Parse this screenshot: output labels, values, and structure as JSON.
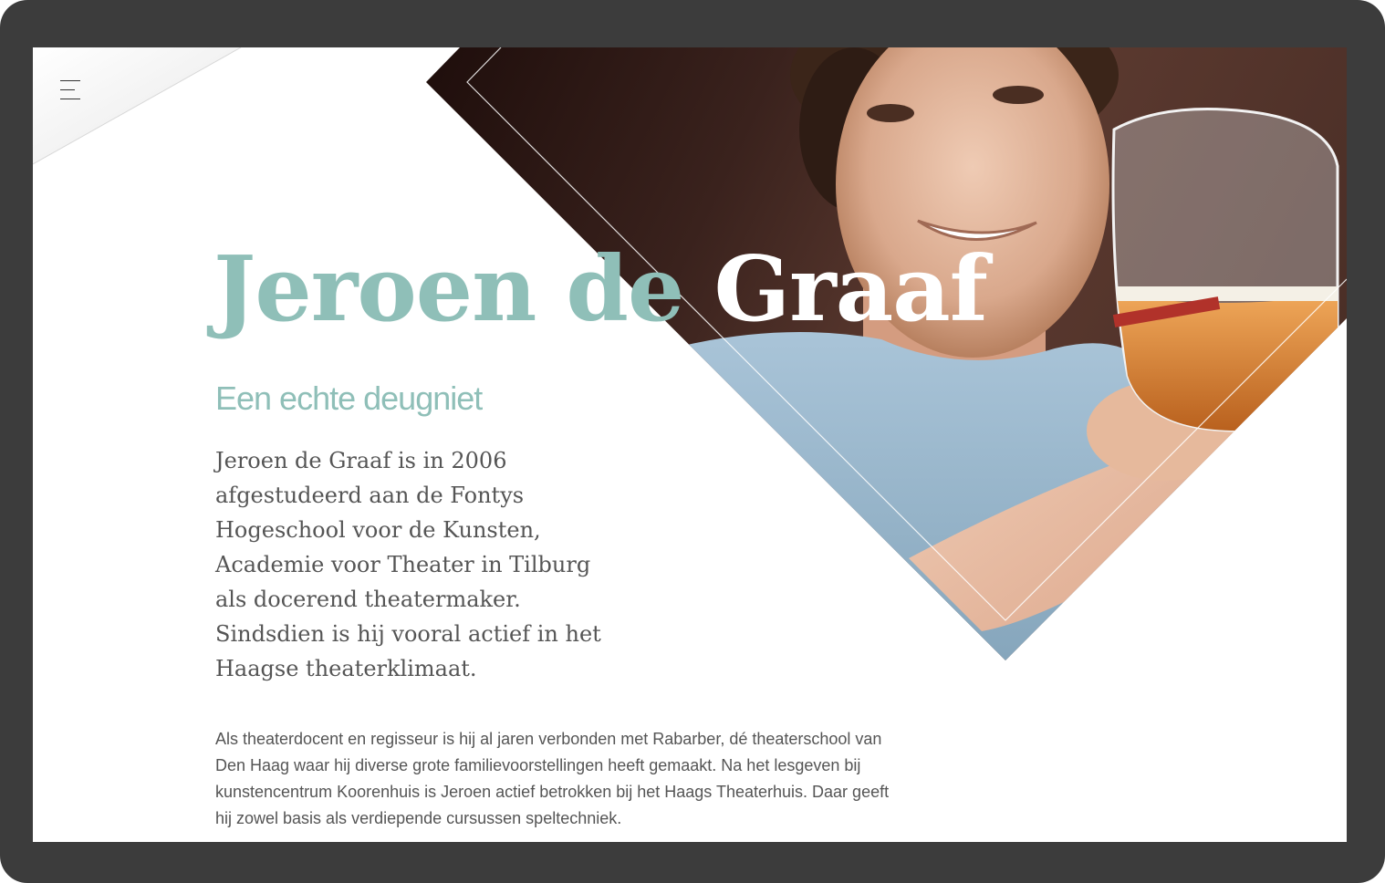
{
  "colors": {
    "frame": "#3c3c3c",
    "accent": "#8fbfb8",
    "text": "#555555",
    "background": "#ffffff"
  },
  "menu": {
    "icon": "hamburger-menu-icon"
  },
  "hero": {
    "name_part1": "Jeroen de ",
    "name_part2": "Graaf",
    "subtitle": "Een echte deugniet",
    "photo_subject": "portrait-photo"
  },
  "content": {
    "intro": "Jeroen de Graaf is in 2006 afgestudeerd aan de Fontys Hogeschool voor de Kunsten, Academie voor Theater in Tilburg als docerend theatermaker. Sindsdien is hij vooral actief in het Haagse theaterklimaat.",
    "body": "Als theaterdocent en regisseur is hij al jaren verbonden met Rabarber, dé theaterschool van Den Haag waar hij diverse grote familievoorstellingen heeft gemaakt. Na het lesgeven bij kunstencentrum Koorenhuis is Jeroen actief betrokken bij het Haags Theaterhuis. Daar geeft hij zowel basis als verdiepende cursussen speltechniek."
  }
}
